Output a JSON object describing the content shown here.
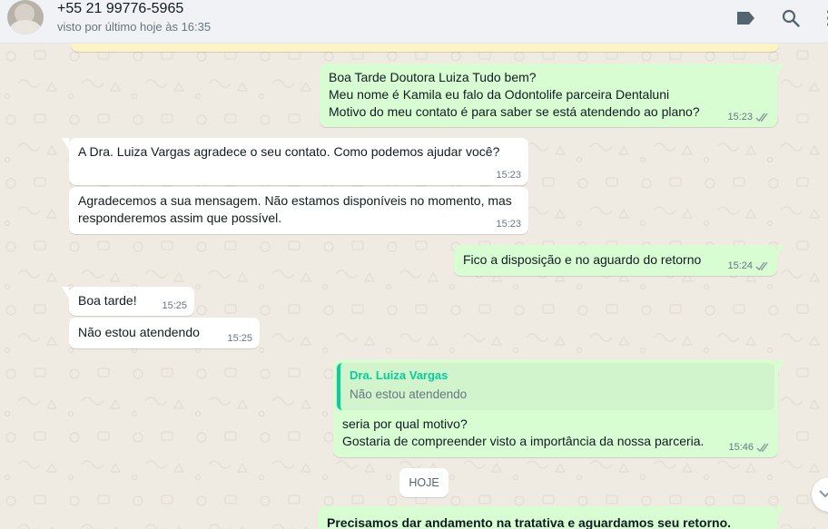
{
  "header": {
    "contact_name": "+55 21 99776-5965",
    "last_seen": "visto por último hoje às 16:35",
    "icons": [
      "label-icon",
      "search-icon",
      "menu-icon"
    ]
  },
  "messages": [
    {
      "direction": "out",
      "text": "Boa Tarde Doutora Luiza Tudo bem?\nMeu nome é Kamila eu falo da Odontolife parceira Dentaluni\nMotivo do meu contato é para saber se está atendendo ao plano?",
      "time": "15:23",
      "status": "read"
    },
    {
      "direction": "in",
      "text": "A Dra. Luiza Vargas agradece o seu contato. Como podemos ajudar você?",
      "time": "15:23"
    },
    {
      "direction": "in",
      "text": "Agradecemos a sua mensagem. Não estamos disponíveis no momento, mas\nresponderemos assim que possível.",
      "time": "15:23"
    },
    {
      "direction": "out",
      "text": "Fico a disposição e no aguardo do retorno",
      "time": "15:24",
      "status": "read"
    },
    {
      "direction": "in",
      "text": "Boa tarde!",
      "time": "15:25"
    },
    {
      "direction": "in",
      "text": "Não estou atendendo",
      "time": "15:25"
    },
    {
      "direction": "out",
      "quoted": {
        "author": "Dra. Luiza Vargas",
        "text": "Não estou atendendo"
      },
      "text": "seria por qual motivo?\nGostaria de compreender visto a importância da nossa parceria.",
      "time": "15:46",
      "status": "read"
    },
    {
      "direction": "out",
      "text": "Precisamos dar andamento na tratativa e aguardamos seu retorno.",
      "bold": true
    }
  ],
  "date_divider": "HOJE",
  "colors": {
    "chat_background": "#efeae2",
    "outgoing_bubble": "#d9fdd3",
    "incoming_bubble": "#ffffff",
    "read_ticks": "#53bdeb",
    "quote_accent": "#06cf9c",
    "header_background": "#f0f2f5"
  }
}
